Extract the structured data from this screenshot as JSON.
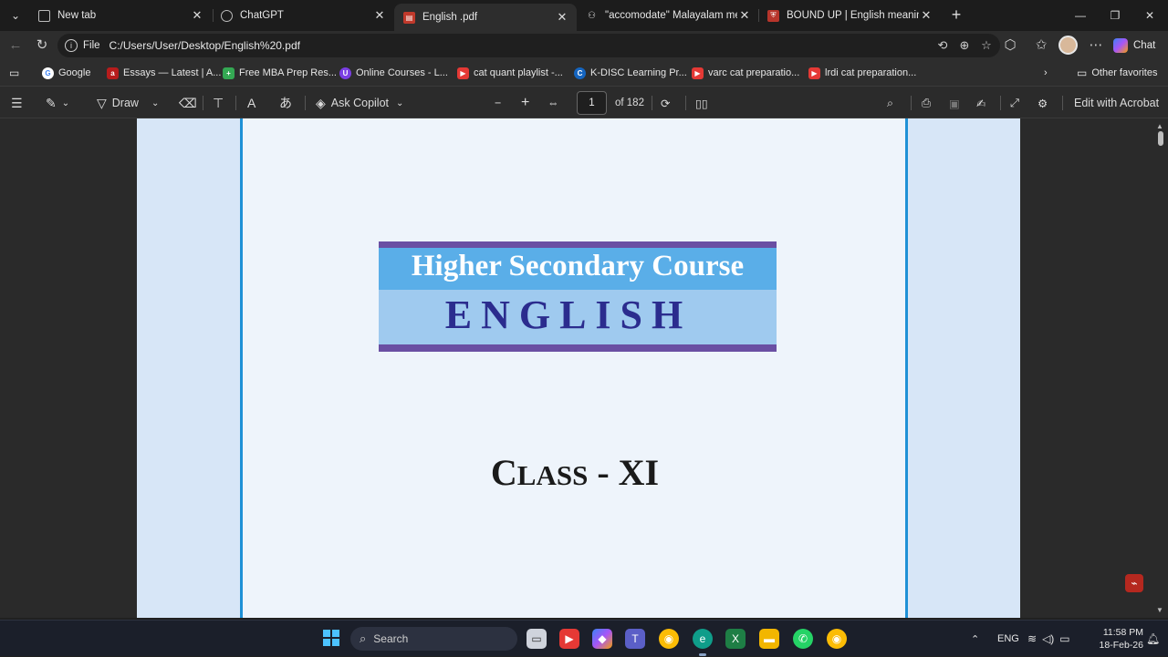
{
  "tabs": [
    {
      "title": "New tab",
      "icon": "newtab-icon",
      "color": "#4a4a4a"
    },
    {
      "title": "ChatGPT",
      "icon": "chatgpt-icon",
      "color": "#3a3a3a"
    },
    {
      "title": "English .pdf",
      "icon": "pdf-icon",
      "color": "#c0392b"
    },
    {
      "title": "\"accomodate\" Malayalam meaning",
      "icon": "glasses-icon",
      "color": "#444"
    },
    {
      "title": "BOUND UP | English meaning - Ca",
      "icon": "cambridge-icon",
      "color": "#b7352b"
    }
  ],
  "address": {
    "scheme": "File",
    "url": "C:/Users/User/Desktop/English%20.pdf"
  },
  "chat_label": "Chat",
  "favorites": [
    {
      "label": "Google",
      "color": "#4285f4",
      "glyph": "G"
    },
    {
      "label": "Essays — Latest | A...",
      "color": "#b71c1c",
      "glyph": "a"
    },
    {
      "label": "Free MBA Prep Res...",
      "color": "#34a853",
      "glyph": "+"
    },
    {
      "label": "Online Courses - L...",
      "color": "#7b3fe4",
      "glyph": "U"
    },
    {
      "label": "cat quant playlist -...",
      "color": "#e53935",
      "glyph": "▶"
    },
    {
      "label": "K-DISC Learning Pr...",
      "color": "#1565c0",
      "glyph": "C"
    },
    {
      "label": "varc cat preparatio...",
      "color": "#e53935",
      "glyph": "▶"
    },
    {
      "label": "lrdi cat preparation...",
      "color": "#e53935",
      "glyph": "▶"
    }
  ],
  "other_favorites": "Other favorites",
  "pdf_toolbar": {
    "draw": "Draw",
    "ask_copilot": "Ask Copilot",
    "page_current": "1",
    "page_total": "of 182",
    "edit_acrobat": "Edit with Acrobat"
  },
  "document": {
    "course": "Higher Secondary Course",
    "subject": "ENGLISH",
    "class_first": "C",
    "class_rest": "LASS",
    "class_suffix": " - XI"
  },
  "taskbar": {
    "search": "Search",
    "language": "ENG",
    "time": "11:58 PM",
    "date": "18-Feb-26"
  },
  "colors": {
    "page_border": "#1e90d6",
    "banner_dark": "#6a4fa3",
    "banner_mid": "#5aaee8",
    "banner_light": "#9fcaef",
    "subject_text": "#2b2c8e"
  }
}
